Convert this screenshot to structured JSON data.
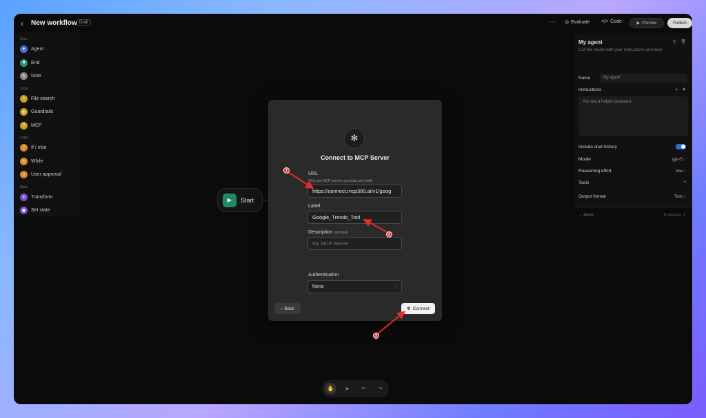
{
  "header": {
    "title": "New workflow",
    "badge": "Draft",
    "more": "⋯",
    "evaluate": "Evaluate",
    "code": "Code",
    "preview": "Preview",
    "publish": "Publish"
  },
  "sidebar": {
    "sections": [
      {
        "title": "Core",
        "items": [
          {
            "label": "Agent",
            "icon": "agent-icon",
            "color": "#4a6fd8",
            "glyph": "✦"
          },
          {
            "label": "End",
            "icon": "end-icon",
            "color": "#2d9a72",
            "glyph": "■"
          },
          {
            "label": "Note",
            "icon": "note-icon",
            "color": "#8a8a8a",
            "glyph": "✎"
          }
        ]
      },
      {
        "title": "Tools",
        "items": [
          {
            "label": "File search",
            "icon": "file-search-icon",
            "color": "#c9a227",
            "glyph": "⌕"
          },
          {
            "label": "Guardrails",
            "icon": "guardrails-icon",
            "color": "#c9a227",
            "glyph": "◈"
          },
          {
            "label": "MCP",
            "icon": "mcp-icon",
            "color": "#c9a227",
            "glyph": "≡"
          }
        ]
      },
      {
        "title": "Logic",
        "items": [
          {
            "label": "If / else",
            "icon": "if-else-icon",
            "color": "#d88a2d",
            "glyph": "⑂"
          },
          {
            "label": "While",
            "icon": "while-icon",
            "color": "#d88a2d",
            "glyph": "↻"
          },
          {
            "label": "User approval",
            "icon": "user-approval-icon",
            "color": "#d88a2d",
            "glyph": "☺"
          }
        ]
      },
      {
        "title": "Data",
        "items": [
          {
            "label": "Transform",
            "icon": "transform-icon",
            "color": "#7b52d6",
            "glyph": "✶"
          },
          {
            "label": "Set state",
            "icon": "set-state-icon",
            "color": "#7b52d6",
            "glyph": "▣"
          }
        ]
      }
    ]
  },
  "canvas": {
    "start_label": "Start"
  },
  "agent_panel": {
    "title": "My agent",
    "subtitle": "Call the model with your instructions and tools",
    "name_label": "Name",
    "name_value": "My agent",
    "instructions_label": "Instructions",
    "instructions_value": "You are a helpful assistant.",
    "chat_history_label": "Include chat history",
    "model_label": "Model",
    "model_value": "gpt-5",
    "reasoning_label": "Reasoning effort",
    "reasoning_value": "low",
    "tools_label": "Tools",
    "output_label": "Output format",
    "output_value": "Text",
    "more_label": "More",
    "evaluate_label": "Evaluate"
  },
  "dialog": {
    "title": "Connect to MCP Server",
    "url_label": "URL",
    "url_hint": "Only use MCP servers you trust and verify",
    "url_value": "https://connect.mcp360.ai/v1/goog",
    "label_label": "Label",
    "label_value": "Google_Trends_Tool",
    "description_label": "Description",
    "description_optional": "(optional)",
    "description_placeholder": "My MCP Server",
    "auth_label": "Authentication",
    "auth_value": "None",
    "back_label": "Back",
    "connect_label": "Connect"
  },
  "annotations": [
    "1",
    "2",
    "3"
  ],
  "colors": {
    "accent_red": "#e52b2b",
    "toggle_blue": "#2a6fdc",
    "start_green": "#1f8a62"
  }
}
